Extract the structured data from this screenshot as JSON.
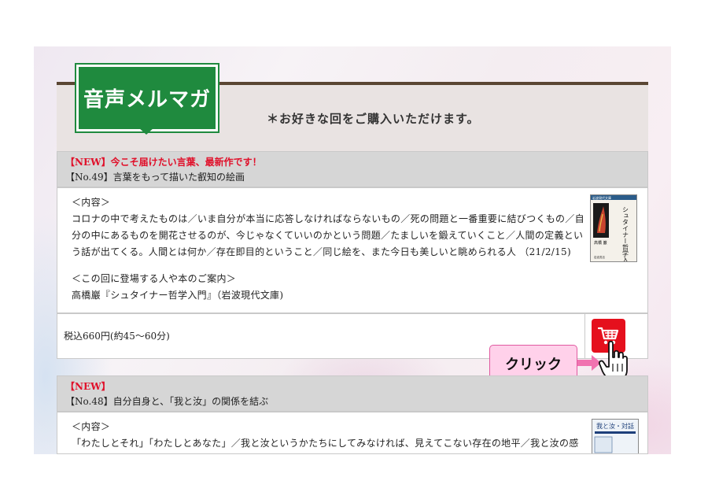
{
  "header": {
    "ribbon_title": "音声メルマガ",
    "subtitle": "＊お好きな回をご購入いただけます。"
  },
  "episodes": [
    {
      "new_label": "【NEW】今こそ届けたい言葉、最新作です！",
      "number_title": "【No.49】言葉をもって描いた叡知の絵画",
      "content_heading": "＜内容＞",
      "content_lines": [
        "コロナの中で考えたものは／いま自分が本当に応答しなければならないもの／死の問題と一番重要に結びつくもの／自",
        "分の中にあるものを開花させるのが、今じゃなくていいのかという問題／たましいを鍛えていくこと／人間の定義とい",
        "う話が出てくる。人間とは何か／存在即目的ということ／同じ絵を、また今日も美しいと眺められる人 （21/2/15)"
      ],
      "guide_heading": "＜この回に登場する人や本のご案内＞",
      "guide_text": "高橋巖『シュタイナー哲学入門』（岩波現代文庫)",
      "book": {
        "series": "岩波現代文庫",
        "title": "シュタイナー哲学入門",
        "author": "高橋 巖",
        "publisher": "岩波書店"
      },
      "price": "税込660円(約45～60分)"
    },
    {
      "new_label": "【NEW】",
      "number_title": "【No.48】自分自身と、「我と汝」の関係を結ぶ",
      "content_heading": "＜内容＞",
      "content_lines": [
        "「わたしとそれ」「わたしとあなた」／我と汝というかたちにしてみなければ、見えてこない存在の地平／我と汝の感"
      ],
      "book": {
        "title": "我と汝・対話"
      }
    }
  ],
  "callout": {
    "label": "クリック"
  },
  "icons": {
    "cart": "cart-icon",
    "hand": "pointer-hand-icon"
  },
  "colors": {
    "ribbon": "#1f8a3e",
    "header_rule": "#5a4633",
    "new_text": "#e0102a",
    "cart_button": "#e5101d",
    "callout_bg": "#ffd1ea"
  }
}
